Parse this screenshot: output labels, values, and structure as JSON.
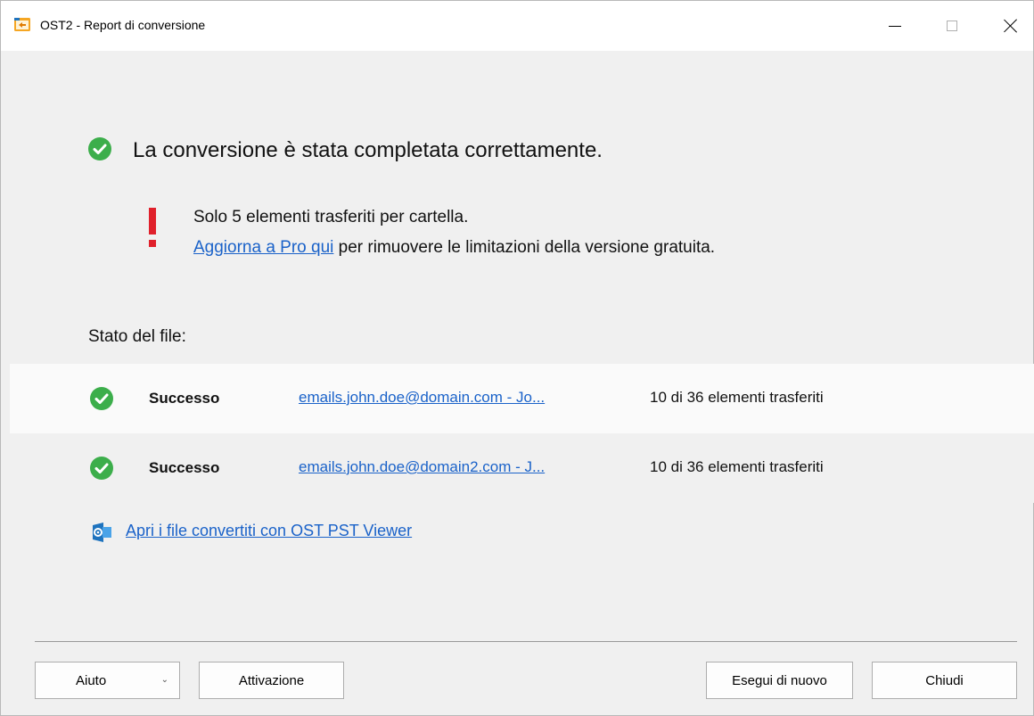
{
  "window": {
    "title": "OST2 - Report di conversione",
    "icon": "app-icon"
  },
  "headline": {
    "icon": "check-circle-icon",
    "text": "La conversione è stata completata correttamente."
  },
  "warning": {
    "icon": "exclamation-icon",
    "line1": "Solo 5 elementi trasferiti per cartella.",
    "link": "Aggiorna a Pro qui",
    "line2_rest": " per rimuovere le limitazioni della versione gratuita."
  },
  "status_label": "Stato del file:",
  "files": [
    {
      "status": "Successo",
      "file": "emails.john.doe@domain.com - Jo...",
      "count": "10 di 36 elementi trasferiti"
    },
    {
      "status": "Successo",
      "file": "emails.john.doe@domain2.com - J...",
      "count": "10 di 36 elementi trasferiti"
    }
  ],
  "viewer_link": {
    "icon": "outlook-viewer-icon",
    "text": "Apri i file convertiti con OST PST Viewer"
  },
  "buttons": {
    "help": "Aiuto",
    "activate": "Attivazione",
    "rerun": "Esegui di nuovo",
    "close": "Chiudi"
  },
  "colors": {
    "success": "#3cae4b",
    "warning": "#e0202b",
    "link": "#1a62c9"
  }
}
